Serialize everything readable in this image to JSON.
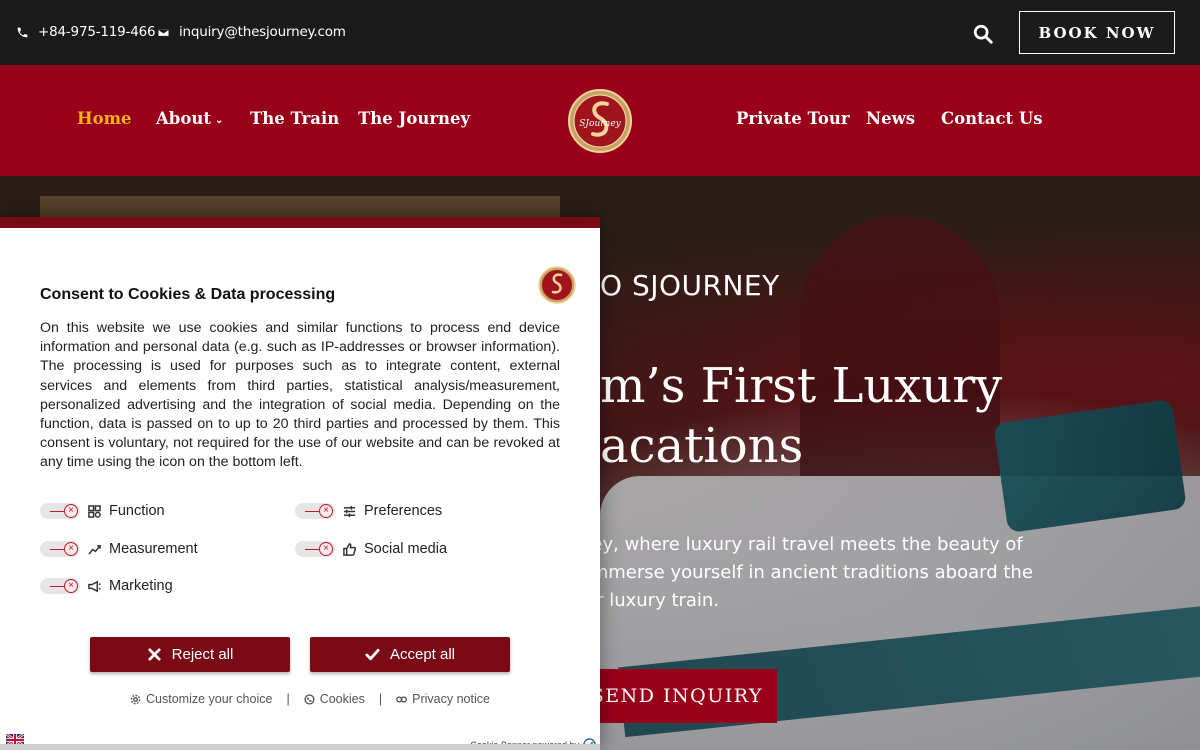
{
  "topbar": {
    "phone": "+84-975-119-466",
    "email": "inquiry@thesjourney.com",
    "book_label": "BOOK NOW",
    "icons": {
      "phone": "phone-icon",
      "email": "envelope-icon",
      "search": "search-icon"
    }
  },
  "nav": {
    "items": [
      {
        "label": "Home",
        "active": true
      },
      {
        "label": "About",
        "dropdown": true
      },
      {
        "label": "The Train"
      },
      {
        "label": "The Journey"
      },
      {
        "label": "Private Tour"
      },
      {
        "label": "News"
      },
      {
        "label": "Contact Us"
      }
    ],
    "logo_text": "SJourney"
  },
  "hero": {
    "eyebrow": "O SJOURNEY",
    "title": "m’s First Luxury\nacations",
    "body": "ney, where luxury rail travel meets the beauty of\n immerse yourself in ancient traditions aboard the\nier luxury train.",
    "cta": "SEND INQUIRY"
  },
  "consent": {
    "title": "Consent to Cookies & Data processing",
    "text": "On this website we use cookies and similar functions to process end device information and personal data (e.g. such as IP-addresses or browser information). The processing is used for purposes such as to integrate content, external services and elements from third parties, statistical analysis/measurement, personalized advertising and the integration of social media. Depending on the function, data is passed on to up to 20 third parties and processed by them. This consent is voluntary, not required for the use of our website and can be revoked at any time using the icon on the bottom left.",
    "categories": [
      {
        "label": "Function",
        "icon": "function-icon"
      },
      {
        "label": "Preferences",
        "icon": "sliders-icon"
      },
      {
        "label": "Measurement",
        "icon": "chart-icon"
      },
      {
        "label": "Social media",
        "icon": "thumbs-up-icon"
      },
      {
        "label": "Marketing",
        "icon": "megaphone-icon"
      }
    ],
    "reject_label": "Reject all",
    "accept_label": "Accept all",
    "links": {
      "customize": "Customize your choice",
      "cookies": "Cookies",
      "privacy": "Privacy notice",
      "sep": "|"
    },
    "powered_by": "Cookie Banner powered by"
  },
  "colors": {
    "brand_red": "#99001a",
    "consent_red": "#7a0a16",
    "nav_active": "#f5b21e",
    "topbar_bg": "#1b1b1b"
  }
}
